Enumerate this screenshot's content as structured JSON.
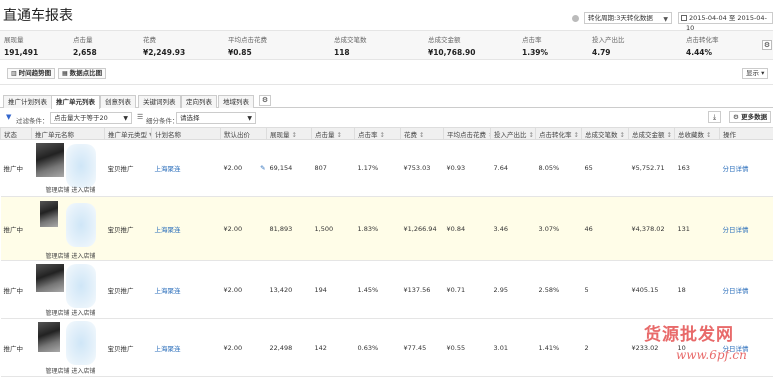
{
  "header": {
    "title": "直通车报表",
    "conversion_period": "转化周期:3天转化数据",
    "date_range": "2015-04-04 至 2015-04-",
    "date_overflow": "10"
  },
  "metrics": [
    {
      "label": "展现量",
      "value": "191,491"
    },
    {
      "label": "点击量",
      "value": "2,658"
    },
    {
      "label": "花费",
      "value": "¥2,249.93"
    },
    {
      "label": "平均点击花费",
      "value": "¥0.85"
    },
    {
      "label": "总成交笔数",
      "value": "118"
    },
    {
      "label": "总成交金额",
      "value": "¥10,768.90"
    },
    {
      "label": "点击率",
      "value": "1.39%"
    },
    {
      "label": "投入产出比",
      "value": "4.79"
    },
    {
      "label": "点击转化率",
      "value": "4.44%"
    }
  ],
  "chart_buttons": {
    "trend": "时间趋势图",
    "scatter": "数据点比图"
  },
  "display_button": "显示",
  "tabs": [
    "推广计划列表",
    "推广单元列表",
    "创意列表",
    "关键词列表",
    "定向列表",
    "地域列表"
  ],
  "filters": {
    "filter_label": "过滤条件：",
    "filter_value": "点击量大于等于20",
    "breakdown_label": "细分条件：",
    "breakdown_value": "请选择"
  },
  "more_data_button": "更多数据",
  "columns": [
    "状态",
    "推广单元名称",
    "推广单元类型",
    "计划名称",
    "默认出价",
    "展现量",
    "点击量",
    "点击率",
    "花费",
    "平均点击花费",
    "投入产出比",
    "点击转化率",
    "总成交笔数",
    "总成交金额",
    "总收藏数",
    "操作"
  ],
  "rows": [
    {
      "status": "推广中",
      "shop": "管理店铺 进入店铺",
      "type": "宝贝推广",
      "plan": "上海聚连",
      "bid": "¥2.00",
      "impressions": "69,154",
      "clicks": "807",
      "ctr": "1.17%",
      "cost": "¥753.03",
      "cpc": "¥0.93",
      "roi": "7.64",
      "cvr": "8.05%",
      "orders": "65",
      "gmv": "¥5,752.71",
      "favs": "163",
      "action": "分日详情"
    },
    {
      "status": "推广中",
      "shop": "管理店铺 进入店铺",
      "type": "宝贝推广",
      "plan": "上海聚连",
      "bid": "¥2.00",
      "impressions": "81,893",
      "clicks": "1,500",
      "ctr": "1.83%",
      "cost": "¥1,266.94",
      "cpc": "¥0.84",
      "roi": "3.46",
      "cvr": "3.07%",
      "orders": "46",
      "gmv": "¥4,378.02",
      "favs": "131",
      "action": "分日详情"
    },
    {
      "status": "推广中",
      "shop": "管理店铺 进入店铺",
      "type": "宝贝推广",
      "plan": "上海聚连",
      "bid": "¥2.00",
      "impressions": "13,420",
      "clicks": "194",
      "ctr": "1.45%",
      "cost": "¥137.56",
      "cpc": "¥0.71",
      "roi": "2.95",
      "cvr": "2.58%",
      "orders": "5",
      "gmv": "¥405.15",
      "favs": "18",
      "action": "分日详情"
    },
    {
      "status": "推广中",
      "shop": "管理店铺 进入店铺",
      "type": "宝贝推广",
      "plan": "上海聚连",
      "bid": "¥2.00",
      "impressions": "22,498",
      "clicks": "142",
      "ctr": "0.63%",
      "cost": "¥77.45",
      "cpc": "¥0.55",
      "roi": "3.01",
      "cvr": "1.41%",
      "orders": "2",
      "gmv": "¥233.02",
      "favs": "10",
      "action": "分日详情"
    }
  ],
  "watermark": {
    "text": "货源批发网",
    "url": "www.6pf.cn"
  }
}
